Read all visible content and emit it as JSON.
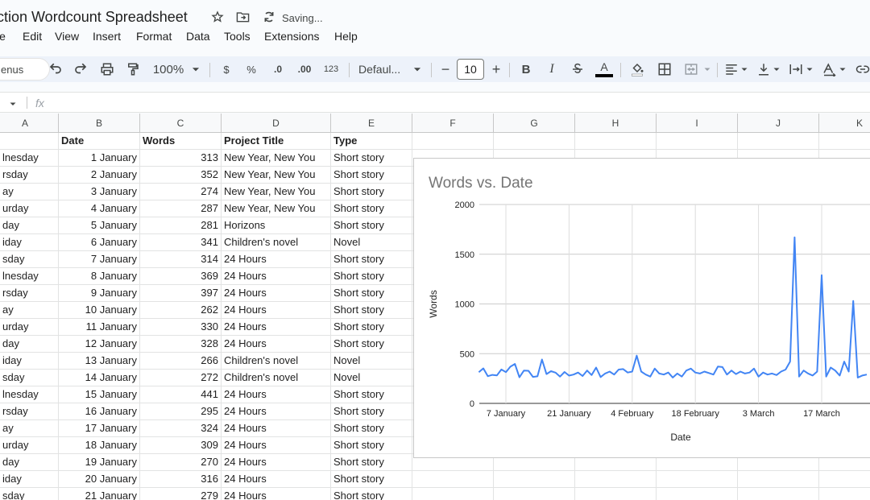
{
  "title": {
    "doc_title": "ction Wordcount Spreadsheet",
    "star_icon": "star-icon",
    "move_icon": "folder-move-icon",
    "status_icon": "sync-icon",
    "status": "Saving..."
  },
  "menu": [
    "le",
    "Edit",
    "View",
    "Insert",
    "Format",
    "Data",
    "Tools",
    "Extensions",
    "Help"
  ],
  "toolbar": {
    "search_label": "enus",
    "zoom": "100%",
    "currency": "$",
    "percent": "%",
    "decrease_decimal": ".0",
    "increase_decimal": ".00",
    "number_format": "123",
    "font": "Defaul...",
    "font_size": "10",
    "bold": "B",
    "italic": "I",
    "text_color": "A"
  },
  "formula_bar": {
    "fx": "fx"
  },
  "columns": [
    "A",
    "B",
    "C",
    "D",
    "E",
    "F",
    "G",
    "H",
    "I",
    "J",
    "K"
  ],
  "sheet": {
    "headers": [
      "",
      "Date",
      "Words",
      "Project Title",
      "Type"
    ],
    "rows": [
      [
        "lnesday",
        "1 January",
        "313",
        "New Year, New You",
        "Short story"
      ],
      [
        "rsday",
        "2 January",
        "352",
        "New Year, New You",
        "Short story"
      ],
      [
        "ay",
        "3 January",
        "274",
        "New Year, New You",
        "Short story"
      ],
      [
        "urday",
        "4 January",
        "287",
        "New Year, New You",
        "Short story"
      ],
      [
        "day",
        "5 January",
        "281",
        "Horizons",
        "Short story"
      ],
      [
        "iday",
        "6 January",
        "341",
        "Children's novel",
        "Novel"
      ],
      [
        "sday",
        "7 January",
        "314",
        "24 Hours",
        "Short story"
      ],
      [
        "lnesday",
        "8 January",
        "369",
        "24 Hours",
        "Short story"
      ],
      [
        "rsday",
        "9 January",
        "397",
        "24 Hours",
        "Short story"
      ],
      [
        "ay",
        "10 January",
        "262",
        "24 Hours",
        "Short story"
      ],
      [
        "urday",
        "11 January",
        "330",
        "24 Hours",
        "Short story"
      ],
      [
        "day",
        "12 January",
        "328",
        "24 Hours",
        "Short story"
      ],
      [
        "iday",
        "13 January",
        "266",
        "Children's novel",
        "Novel"
      ],
      [
        "sday",
        "14 January",
        "272",
        "Children's novel",
        "Novel"
      ],
      [
        "lnesday",
        "15 January",
        "441",
        "24 Hours",
        "Short story"
      ],
      [
        "rsday",
        "16 January",
        "295",
        "24 Hours",
        "Short story"
      ],
      [
        "ay",
        "17 January",
        "324",
        "24 Hours",
        "Short story"
      ],
      [
        "urday",
        "18 January",
        "309",
        "24 Hours",
        "Short story"
      ],
      [
        "day",
        "19 January",
        "270",
        "24 Hours",
        "Short story"
      ],
      [
        "iday",
        "20 January",
        "316",
        "24 Hours",
        "Short story"
      ],
      [
        "sday",
        "21 January",
        "279",
        "24 Hours",
        "Short story"
      ]
    ]
  },
  "chart_data": {
    "type": "line",
    "title": "Words vs. Date",
    "xlabel": "Date",
    "ylabel": "Words",
    "ylim": [
      0,
      2000
    ],
    "yticks": [
      0,
      500,
      1000,
      1500,
      2000
    ],
    "xticks": [
      "7 January",
      "21 January",
      "4 February",
      "18 February",
      "3 March",
      "17 March"
    ],
    "xtick_days": [
      7,
      21,
      35,
      49,
      63,
      77
    ],
    "grid": true,
    "legend": "none",
    "series_color": "#4285f4",
    "series": [
      {
        "x_days": [
          1,
          2,
          3,
          4,
          5,
          6,
          7,
          8,
          9,
          10,
          11,
          12,
          13,
          14,
          15,
          16,
          17,
          18,
          19,
          20,
          21,
          22,
          23,
          24,
          25,
          26,
          27,
          28,
          29,
          30,
          31,
          32,
          33,
          34,
          35,
          36,
          37,
          38,
          39,
          40,
          41,
          42,
          43,
          44,
          45,
          46,
          47,
          48,
          49,
          50,
          51,
          52,
          53,
          54,
          55,
          56,
          57,
          58,
          59,
          60,
          61,
          62,
          63,
          64,
          65,
          66,
          67,
          68,
          69,
          70,
          71,
          72,
          73,
          74,
          75,
          76,
          77,
          78,
          79,
          80,
          81,
          82,
          83,
          84,
          85,
          86,
          87
        ],
        "values": [
          313,
          352,
          274,
          287,
          281,
          341,
          314,
          369,
          397,
          262,
          330,
          328,
          266,
          272,
          441,
          295,
          324,
          309,
          270,
          316,
          279,
          290,
          310,
          275,
          330,
          285,
          360,
          265,
          300,
          320,
          290,
          340,
          345,
          310,
          320,
          480,
          320,
          290,
          270,
          350,
          300,
          290,
          310,
          260,
          300,
          270,
          330,
          350,
          310,
          300,
          320,
          305,
          290,
          370,
          365,
          290,
          330,
          295,
          320,
          300,
          310,
          350,
          270,
          310,
          290,
          300,
          285,
          320,
          340,
          420,
          1670,
          270,
          330,
          300,
          280,
          320,
          1290,
          270,
          360,
          330,
          280,
          420,
          320,
          1030,
          260,
          280,
          290
        ]
      }
    ]
  }
}
